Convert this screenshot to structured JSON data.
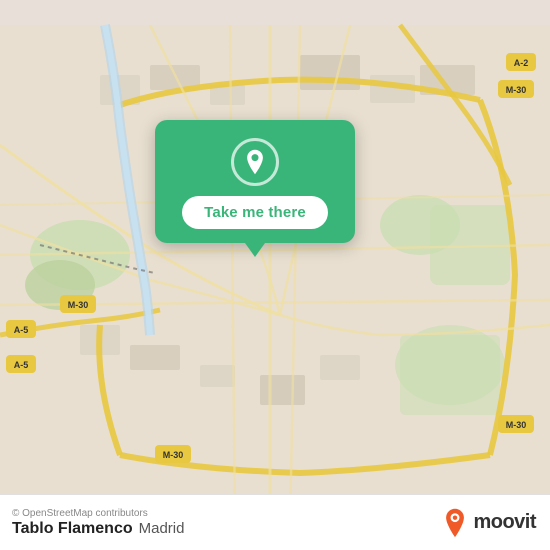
{
  "map": {
    "attribution": "© OpenStreetMap contributors",
    "background_color": "#e8dfd0"
  },
  "popup": {
    "button_label": "Take me there",
    "icon_name": "location-pin-icon"
  },
  "bottom_bar": {
    "place_name": "Tablo Flamenco",
    "place_city": "Madrid",
    "osm_text": "© OpenStreetMap contributors",
    "logo_text": "moovit"
  },
  "colors": {
    "green": "#3ab57a",
    "white": "#ffffff",
    "road_yellow": "#f5e14a",
    "road_light": "#f0e9d8",
    "highway_orange": "#e8a040"
  }
}
